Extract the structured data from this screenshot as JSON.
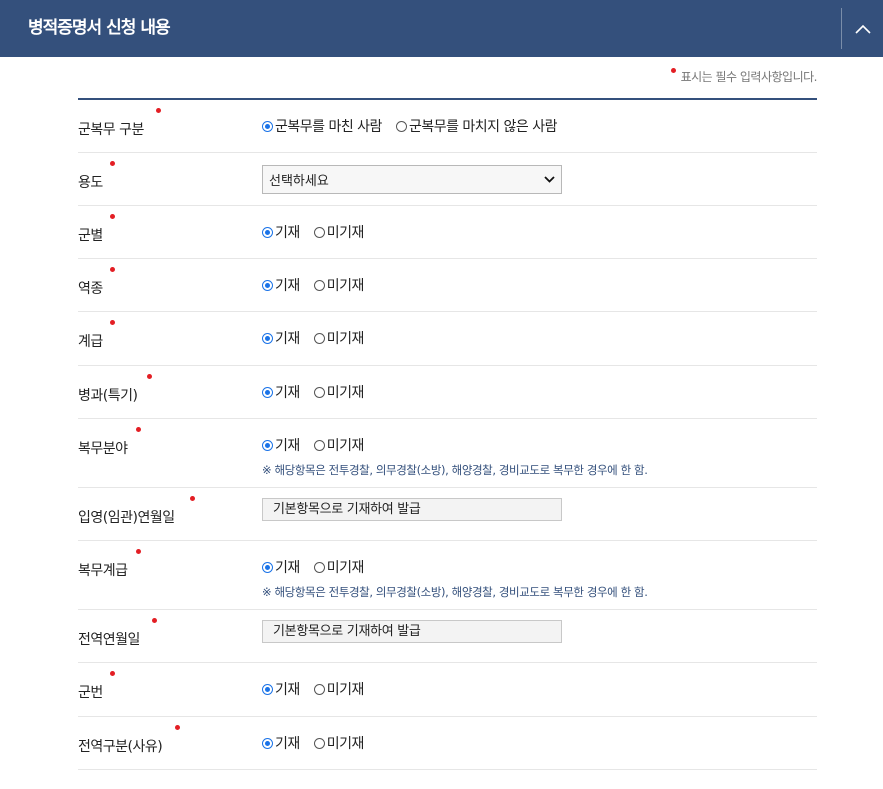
{
  "header": {
    "title": "병적증명서 신청 내용",
    "toggle_icon": "chevron-up-icon"
  },
  "required_note": "표시는 필수 입력사항입니다.",
  "colors": {
    "header_bg": "#34507c",
    "required_dot": "#e31e24",
    "radio_checked": "#1a73e8",
    "note_text": "#34507c"
  },
  "rows": [
    {
      "label": "군복무 구분",
      "type": "radio",
      "options": [
        "군복무를 마친 사람",
        "군복무를 마치지 않은 사람"
      ],
      "selected": 0
    },
    {
      "label": "용도",
      "type": "select",
      "value": "선택하세요"
    },
    {
      "label": "군별",
      "type": "radio",
      "options": [
        "기재",
        "미기재"
      ],
      "selected": 0
    },
    {
      "label": "역종",
      "type": "radio",
      "options": [
        "기재",
        "미기재"
      ],
      "selected": 0
    },
    {
      "label": "계급",
      "type": "radio",
      "options": [
        "기재",
        "미기재"
      ],
      "selected": 0
    },
    {
      "label": "병과(특기)",
      "type": "radio",
      "options": [
        "기재",
        "미기재"
      ],
      "selected": 0
    },
    {
      "label": "복무분야",
      "type": "radio",
      "options": [
        "기재",
        "미기재"
      ],
      "selected": 0,
      "note": "※ 해당항목은 전투경찰, 의무경찰(소방), 해양경찰, 경비교도로 복무한 경우에 한 함."
    },
    {
      "label": "입영(임관)연월일",
      "type": "text",
      "value": "기본항목으로 기재하여 발급"
    },
    {
      "label": "복무계급",
      "type": "radio",
      "options": [
        "기재",
        "미기재"
      ],
      "selected": 0,
      "note": "※ 해당항목은 전투경찰, 의무경찰(소방), 해양경찰, 경비교도로 복무한 경우에 한 함."
    },
    {
      "label": "전역연월일",
      "type": "text",
      "value": "기본항목으로 기재하여 발급"
    },
    {
      "label": "군번",
      "type": "radio",
      "options": [
        "기재",
        "미기재"
      ],
      "selected": 0
    },
    {
      "label": "전역구분(사유)",
      "type": "radio",
      "options": [
        "기재",
        "미기재"
      ],
      "selected": 0
    }
  ]
}
